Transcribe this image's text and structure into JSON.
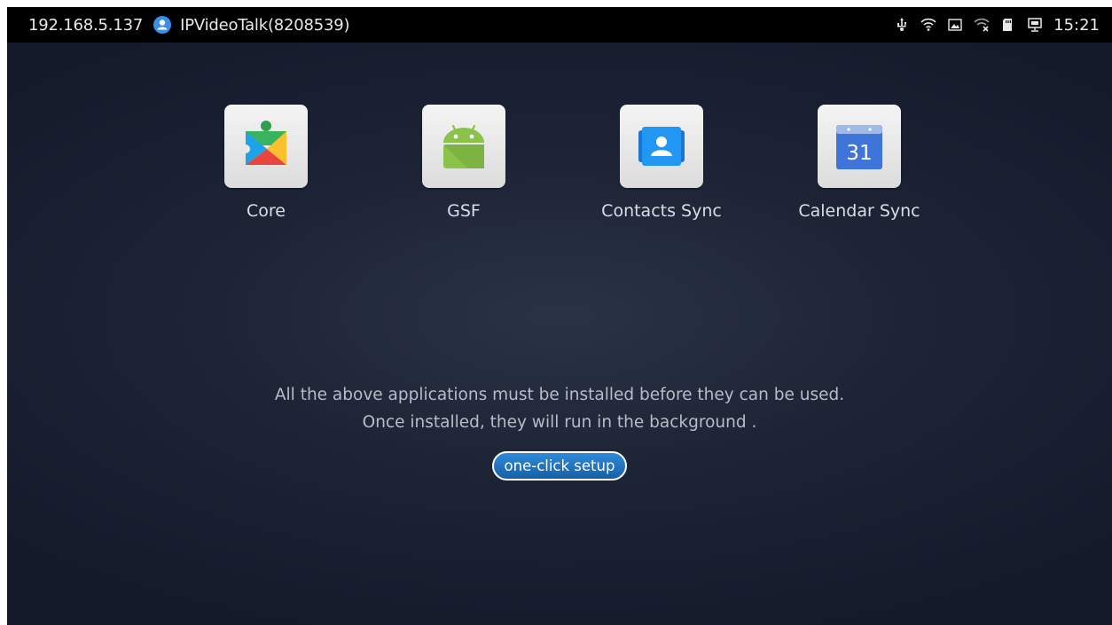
{
  "status_bar": {
    "ip_address": "192.168.5.137",
    "account_name": "IPVideoTalk(8208539)",
    "time": "15:21",
    "icons": [
      "usb-icon",
      "wifi-icon",
      "screenshot-icon",
      "wifi-off-icon",
      "sd-card-icon",
      "display-icon"
    ]
  },
  "apps": [
    {
      "label": "Core",
      "icon": "google-play-services-icon"
    },
    {
      "label": "GSF",
      "icon": "android-icon"
    },
    {
      "label": "Contacts Sync",
      "icon": "contacts-icon"
    },
    {
      "label": "Calendar Sync",
      "icon": "calendar-icon",
      "icon_text": "31"
    }
  ],
  "message": {
    "line1": "All the above applications must be installed before they can be used.",
    "line2": "Once installed, they will run in the background ."
  },
  "setup_button": {
    "label": "one-click setup"
  },
  "colors": {
    "background": "#1d2436",
    "status_bar": "#000000",
    "button": "#1e72c0",
    "text": "#b7bcc6"
  }
}
